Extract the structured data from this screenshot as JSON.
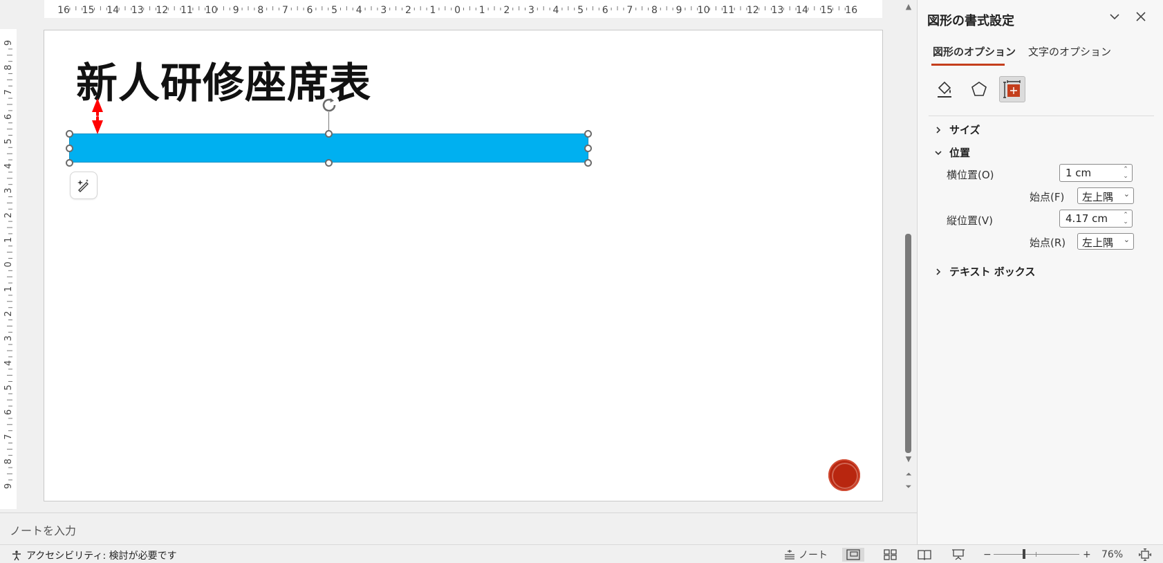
{
  "ruler": {
    "top_labels": [
      "16",
      "15",
      "14",
      "13",
      "12",
      "11",
      "10",
      "9",
      "8",
      "7",
      "6",
      "5",
      "4",
      "3",
      "2",
      "1",
      "0",
      "1",
      "2",
      "3",
      "4",
      "5",
      "6",
      "7",
      "8",
      "9",
      "10",
      "11",
      "12",
      "13",
      "14",
      "15",
      "16"
    ],
    "left_labels": [
      "9",
      "8",
      "7",
      "6",
      "5",
      "4",
      "3",
      "2",
      "1",
      "0",
      "1",
      "2",
      "3",
      "4",
      "5",
      "6",
      "7",
      "8",
      "9"
    ]
  },
  "slide": {
    "title": "新人研修座席表",
    "shape_color": "#00b0f0",
    "stamp_color": "#b8260f"
  },
  "notes": {
    "placeholder": "ノートを入力"
  },
  "pane": {
    "title": "図形の書式設定",
    "tabs": [
      {
        "label": "図形のオプション",
        "active": true
      },
      {
        "label": "文字のオプション",
        "active": false
      }
    ],
    "icons": [
      "fill-line-icon",
      "effects-icon",
      "size-properties-icon"
    ],
    "sections": {
      "size": "サイズ",
      "position": "位置",
      "textbox": "テキスト ボックス"
    },
    "fields": {
      "horizontal_label": "横位置(O)",
      "horizontal_value": "1 cm",
      "h_origin_label": "始点(F)",
      "h_origin_value": "左上隅",
      "vertical_label": "縦位置(V)",
      "vertical_value": "4.17 cm",
      "v_origin_label": "始点(R)",
      "v_origin_value": "左上隅"
    },
    "accent": "#c43e1c"
  },
  "status": {
    "accessibility": "アクセシビリティ: 検討が必要です",
    "notes_label": "ノート",
    "zoom_minus": "−",
    "zoom_plus": "+",
    "zoom": "76%"
  }
}
